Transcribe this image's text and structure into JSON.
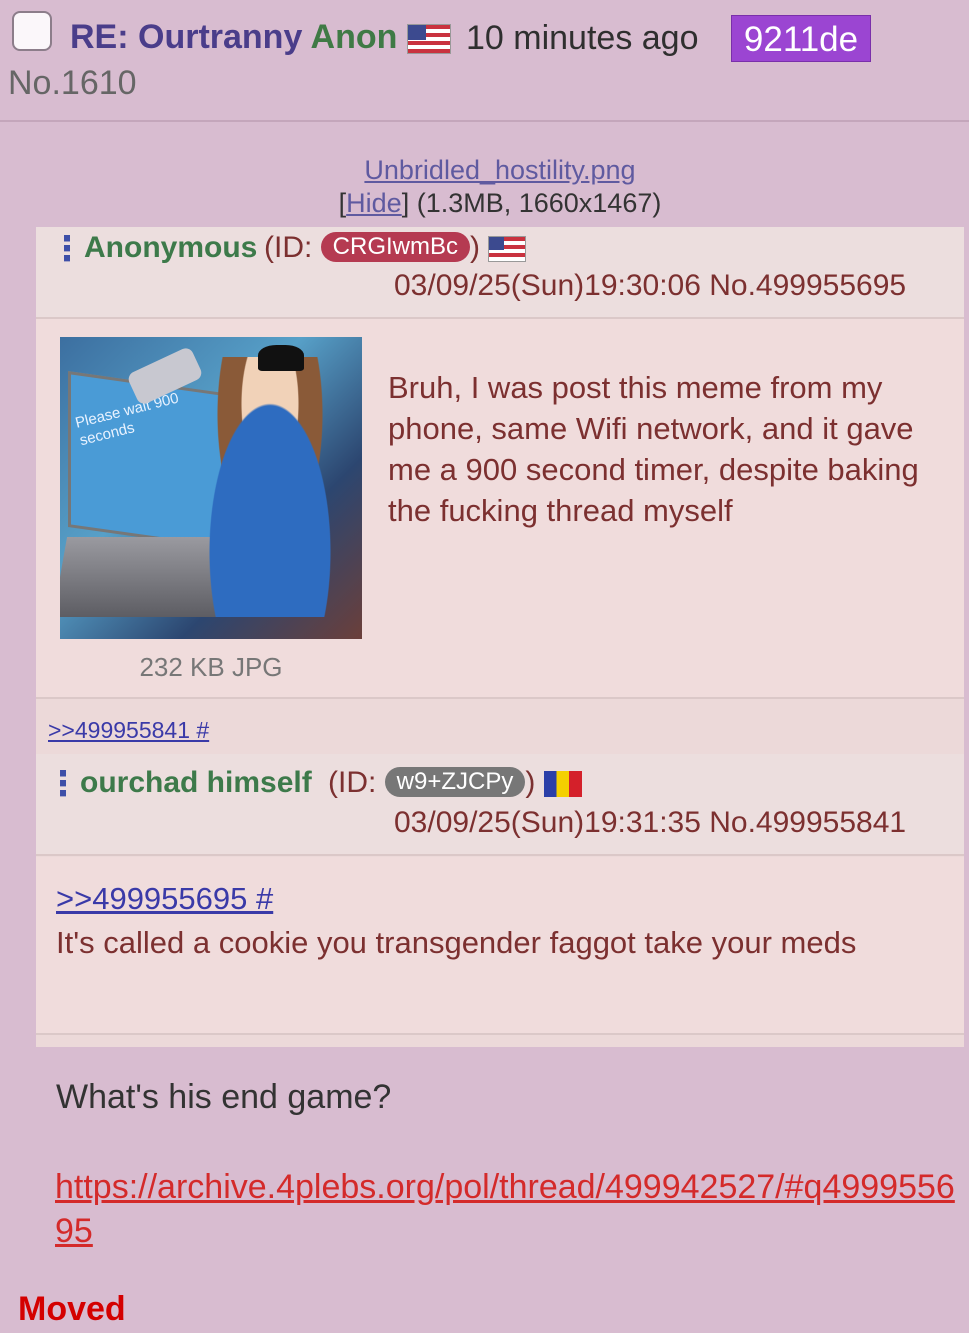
{
  "post": {
    "subject_prefix": "RE: Ourtranny",
    "name": "Anon",
    "time_ago": "10 minutes ago",
    "poster_id": "9211de",
    "number": "No.1610"
  },
  "file": {
    "filename": "Unbridled_hostility.png",
    "hide_label": "Hide",
    "meta": "(1.3MB, 1660x1467)"
  },
  "screenshot": {
    "post1": {
      "name": "Anonymous",
      "id_prefix": "(ID:",
      "id": "CRGIwmBc",
      "id_suffix": ")",
      "datetime": "03/09/25(Sun)19:30:06 No.499955695",
      "thumbnail_screen_text": "Please wait 900 seconds",
      "thumb_caption": "232 KB JPG",
      "text": "Bruh, I was post this meme from my phone, same Wifi network, and it gave me a 900 second timer, despite baking the fucking thread myself"
    },
    "backlink": ">>499955841 #",
    "post2": {
      "name": "ourchad himself",
      "id_prefix": "(ID:",
      "id": "w9+ZJCPy",
      "id_suffix": ")",
      "datetime": "03/09/25(Sun)19:31:35 No.499955841",
      "quote": ">>499955695 #",
      "text": "It's called a cookie you transgender faggot take your meds"
    }
  },
  "question": "What's his end game?",
  "archive_link": "https://archive.4plebs.org/pol/thread/499942527/#q499955695",
  "moved_label": "Moved",
  "colors": {
    "background": "#d8bcd0",
    "id_badge": "#9b45d2",
    "link_red": "#d42a2a",
    "moved": "#d40000"
  }
}
